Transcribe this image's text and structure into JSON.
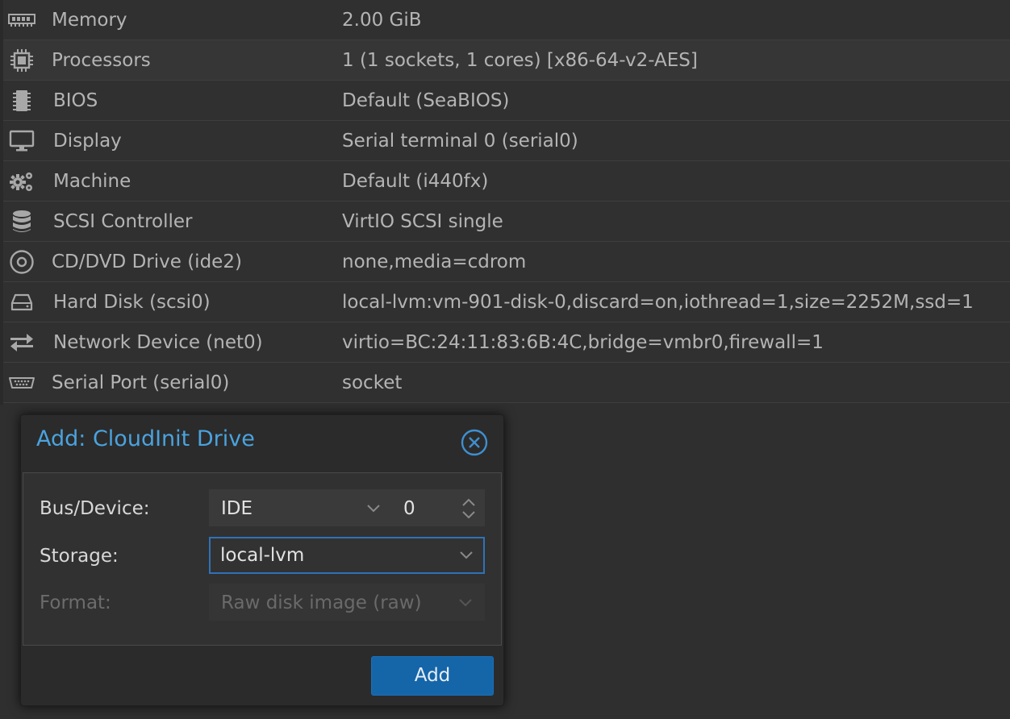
{
  "hardware": {
    "rows": [
      {
        "icon": "memory-icon",
        "name": "Memory",
        "value": "2.00 GiB"
      },
      {
        "icon": "processor-icon",
        "name": "Processors",
        "value": "1 (1 sockets, 1 cores) [x86-64-v2-AES]"
      },
      {
        "icon": "bios-chip-icon",
        "name": "BIOS",
        "value": "Default (SeaBIOS)"
      },
      {
        "icon": "monitor-icon",
        "name": "Display",
        "value": "Serial terminal 0 (serial0)"
      },
      {
        "icon": "gears-icon",
        "name": "Machine",
        "value": "Default (i440fx)"
      },
      {
        "icon": "database-icon",
        "name": "SCSI Controller",
        "value": "VirtIO SCSI single"
      },
      {
        "icon": "cdrom-icon",
        "name": "CD/DVD Drive (ide2)",
        "value": "none,media=cdrom"
      },
      {
        "icon": "hard-disk-icon",
        "name": "Hard Disk (scsi0)",
        "value": "local-lvm:vm-901-disk-0,discard=on,iothread=1,size=2252M,ssd=1"
      },
      {
        "icon": "exchange-arrows-icon",
        "name": "Network Device (net0)",
        "value": "virtio=BC:24:11:83:6B:4C,bridge=vmbr0,firewall=1"
      },
      {
        "icon": "serial-port-icon",
        "name": "Serial Port (serial0)",
        "value": "socket"
      }
    ]
  },
  "dialog": {
    "title": "Add: CloudInit Drive",
    "fields": {
      "bus_device": {
        "label": "Bus/Device:",
        "bus": "IDE",
        "device": "0"
      },
      "storage": {
        "label": "Storage:",
        "value": "local-lvm"
      },
      "format": {
        "label": "Format:",
        "value": "Raw disk image (raw)"
      }
    },
    "add_label": "Add"
  },
  "colors": {
    "accent": "#4aa3df",
    "button": "#1565a9",
    "focus_border": "#2f72b8"
  }
}
